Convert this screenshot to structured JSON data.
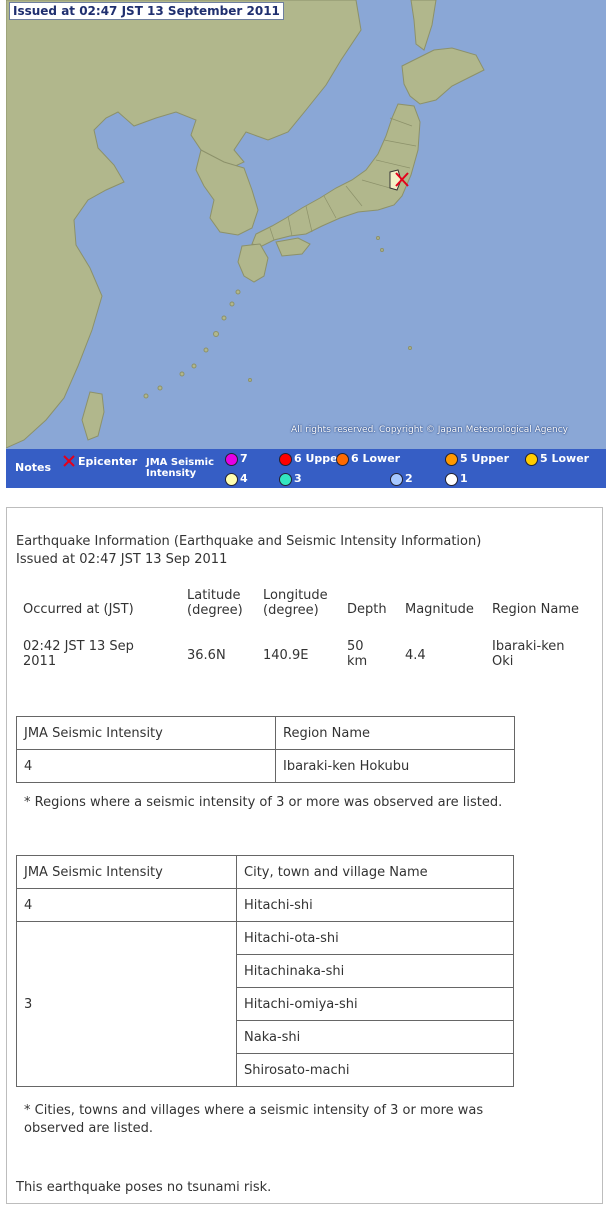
{
  "map": {
    "issued_stamp": "Issued at 02:47 JST  13 September 2011",
    "copyright": "All rights reserved. Copyright © Japan Meteorological Agency",
    "colors": {
      "sea": "#8aa7d6",
      "land": "#b1b78c",
      "highlight": "#f3f0c8",
      "epicenter": "#e4001b",
      "legend_bg": "#365ec5"
    }
  },
  "legend": {
    "notes": "Notes",
    "epicenter": "Epicenter",
    "jma_line1": "JMA Seismic",
    "jma_line2": "Intensity",
    "items": [
      {
        "label": "7",
        "color": "#e600e6"
      },
      {
        "label": "6 Upper",
        "color": "#ff0000"
      },
      {
        "label": "6 Lower",
        "color": "#ff6a00"
      },
      {
        "label": "5 Upper",
        "color": "#ff9900"
      },
      {
        "label": "5 Lower",
        "color": "#ffcc00"
      },
      {
        "label": "4",
        "color": "#ffffb0"
      },
      {
        "label": "3",
        "color": "#33e6c0"
      },
      {
        "label": "2",
        "color": "#a6c8ff"
      },
      {
        "label": "1",
        "color": "#ffffff"
      }
    ]
  },
  "info": {
    "title": "Earthquake Information (Earthquake and Seismic Intensity Information)",
    "issued": "Issued at 02:47 JST 13 Sep 2011",
    "summary_headers": {
      "occurred": "Occurred at (JST)",
      "lat1": "Latitude",
      "lat2": "(degree)",
      "lon1": "Longitude",
      "lon2": "(degree)",
      "depth": "Depth",
      "magnitude": "Magnitude",
      "region": "Region Name"
    },
    "summary_values": {
      "occurred1": "02:42 JST 13 Sep",
      "occurred2": "2011",
      "lat": "36.6N",
      "lon": "140.9E",
      "depth1": "50",
      "depth2": "km",
      "magnitude": "4.4",
      "region1": "Ibaraki-ken",
      "region2": "Oki"
    },
    "region_table": {
      "header_intensity": "JMA Seismic Intensity",
      "header_region": "Region Name",
      "rows": [
        {
          "intensity": "4",
          "region": "Ibaraki-ken Hokubu"
        }
      ]
    },
    "region_note": "* Regions where a seismic intensity of 3 or more was observed are listed.",
    "city_table": {
      "header_intensity": "JMA Seismic Intensity",
      "header_city": "City, town and village Name",
      "group4": {
        "intensity": "4",
        "cities": [
          "Hitachi-shi"
        ]
      },
      "group3": {
        "intensity": "3",
        "cities": [
          "Hitachi-ota-shi",
          "Hitachinaka-shi",
          "Hitachi-omiya-shi",
          "Naka-shi",
          "Shirosato-machi"
        ]
      }
    },
    "city_note": "* Cities, towns and villages where a seismic intensity of 3 or more was observed are listed.",
    "tsunami": "This earthquake poses no tsunami risk."
  }
}
